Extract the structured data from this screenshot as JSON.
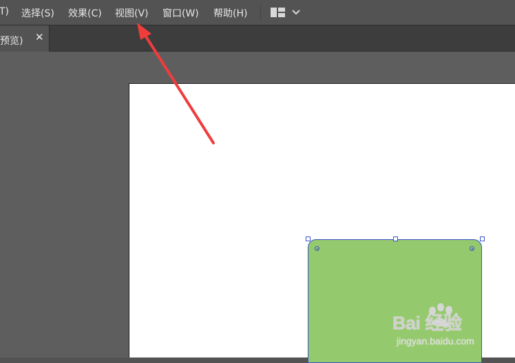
{
  "menubar": {
    "items": [
      {
        "label": "T)"
      },
      {
        "label": "选择(S)"
      },
      {
        "label": "效果(C)"
      },
      {
        "label": "视图(V)"
      },
      {
        "label": "窗口(W)"
      },
      {
        "label": "帮助(H)"
      }
    ],
    "workspace_icon": "workspace-layout-icon",
    "dropdown_icon": "chevron-down-icon"
  },
  "tabs": {
    "active_label": "预览)",
    "close_glyph": "✕"
  },
  "canvas": {
    "shape_fill": "#95c96d",
    "selection_color": "#3553c8",
    "artboard_color": "#ffffff"
  },
  "annotation": {
    "arrow_color": "#f03c3c"
  },
  "watermark": {
    "brand": "Bai  经验",
    "url": "jingyan.baidu.com"
  }
}
